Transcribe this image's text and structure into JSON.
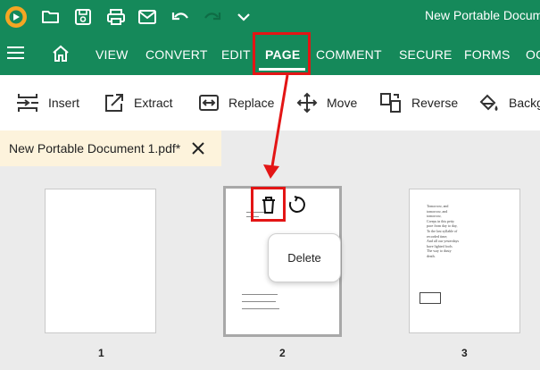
{
  "app": {
    "title": "New Portable Document"
  },
  "menu": {
    "items": [
      "VIEW",
      "CONVERT",
      "EDIT",
      "PAGE",
      "COMMENT",
      "SECURE",
      "FORMS",
      "OC"
    ],
    "active": "PAGE"
  },
  "toolbar": {
    "insert": "Insert",
    "extract": "Extract",
    "replace": "Replace",
    "move": "Move",
    "reverse": "Reverse",
    "background": "Backg"
  },
  "document_tab": {
    "label": "New Portable Document 1.pdf*"
  },
  "pages": [
    {
      "number": "1"
    },
    {
      "number": "2"
    },
    {
      "number": "3"
    }
  ],
  "context_menu": {
    "delete_label": "Delete"
  },
  "page3_text": {
    "lines": [
      "Tomorrow, and",
      "tomorrow, and",
      "tomorrow,",
      "Creeps in this petty",
      "pace from day to day,",
      "To the last syllable of",
      "recorded time;",
      "And all our yesterdays",
      "have lighted fools",
      "The way to dusty",
      "death."
    ]
  },
  "colors": {
    "brand": "#15895a",
    "highlight": "#e31515"
  }
}
